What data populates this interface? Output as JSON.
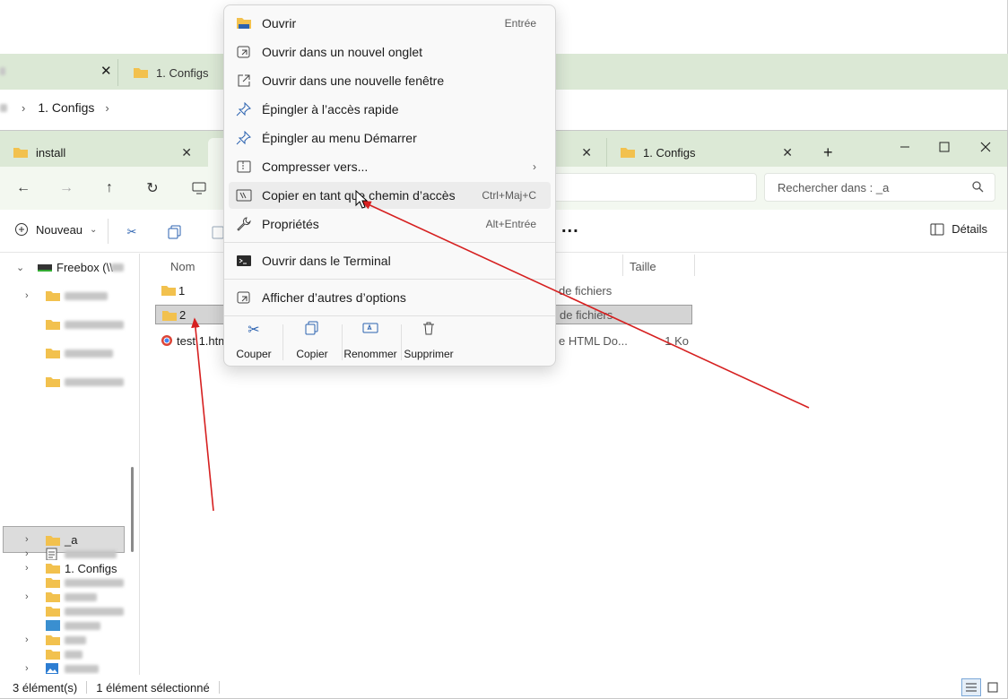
{
  "background_window": {
    "tab_active_label": "1. Configs",
    "breadcrumb_item": "1. Configs"
  },
  "tabs": [
    {
      "label": "install"
    },
    {
      "label": ""
    },
    {
      "label": ""
    },
    {
      "label": "1. Configs"
    }
  ],
  "search": {
    "placeholder": "Rechercher dans : _a"
  },
  "toolbar": {
    "new_label": "Nouveau",
    "more_label": "...",
    "details_label": "Détails"
  },
  "sidebar": {
    "items": [
      {
        "label": "Freebox (\\\\",
        "chevron": "expanded"
      },
      {
        "label": "",
        "blurred": true
      },
      {
        "label": "",
        "blurred": true
      },
      {
        "label": "",
        "blurred": true
      },
      {
        "label": "",
        "blurred": true
      },
      {
        "label": "_a",
        "selected": true
      },
      {
        "label": "1. Configs"
      },
      {
        "label": "",
        "blurred": true
      },
      {
        "label": "",
        "blurred": true
      },
      {
        "label": "",
        "blurred": true
      },
      {
        "label": "",
        "blurred": true
      },
      {
        "label": "",
        "blurred": true
      },
      {
        "label": "",
        "blurred": true
      },
      {
        "label": "",
        "blurred": true
      },
      {
        "label": "",
        "blurred": true
      }
    ]
  },
  "columns": {
    "name": "Nom",
    "size": "Taille"
  },
  "files": [
    {
      "name": "1",
      "type": "de fichiers",
      "size": ""
    },
    {
      "name": "2",
      "type": "de fichiers",
      "size": "",
      "selected": true
    },
    {
      "name": "test 1.htm",
      "type": "e HTML Do...",
      "size": "1 Ko"
    }
  ],
  "status": {
    "count": "3 élément(s)",
    "selection": "1 élément sélectionné"
  },
  "context_menu": {
    "items": [
      {
        "label": "Ouvrir",
        "shortcut": "Entrée",
        "icon": "folder-icon"
      },
      {
        "label": "Ouvrir dans un nouvel onglet",
        "shortcut": "",
        "icon": "new-tab-icon"
      },
      {
        "label": "Ouvrir dans une nouvelle fenêtre",
        "shortcut": "",
        "icon": "new-window-icon"
      },
      {
        "label": "Épingler à l’accès rapide",
        "shortcut": "",
        "icon": "pin-icon"
      },
      {
        "label": "Épingler au menu Démarrer",
        "shortcut": "",
        "icon": "pin-icon"
      },
      {
        "label": "Compresser vers...",
        "shortcut": "",
        "icon": "zip-icon"
      },
      {
        "label": "Copier en tant que chemin d’accès",
        "shortcut": "Ctrl+Maj+C",
        "icon": "copy-path-icon"
      },
      {
        "label": "Propriétés",
        "shortcut": "Alt+Entrée",
        "icon": "wrench-icon"
      },
      {
        "label": "Ouvrir dans le Terminal",
        "shortcut": "",
        "icon": "terminal-icon"
      },
      {
        "label": "Afficher d’autres d’options",
        "shortcut": "",
        "icon": "more-options-icon"
      }
    ],
    "actions": [
      {
        "label": "Couper",
        "icon": "scissors-icon"
      },
      {
        "label": "Copier",
        "icon": "copy-icon"
      },
      {
        "label": "Renommer",
        "icon": "rename-icon"
      },
      {
        "label": "Supprimer",
        "icon": "trash-icon"
      }
    ]
  },
  "colors": {
    "tabbar": "#dce9d6",
    "annotation_arrow": "#d62020",
    "folder": "#f2c14e",
    "accent_icon": "#2b62b0"
  }
}
